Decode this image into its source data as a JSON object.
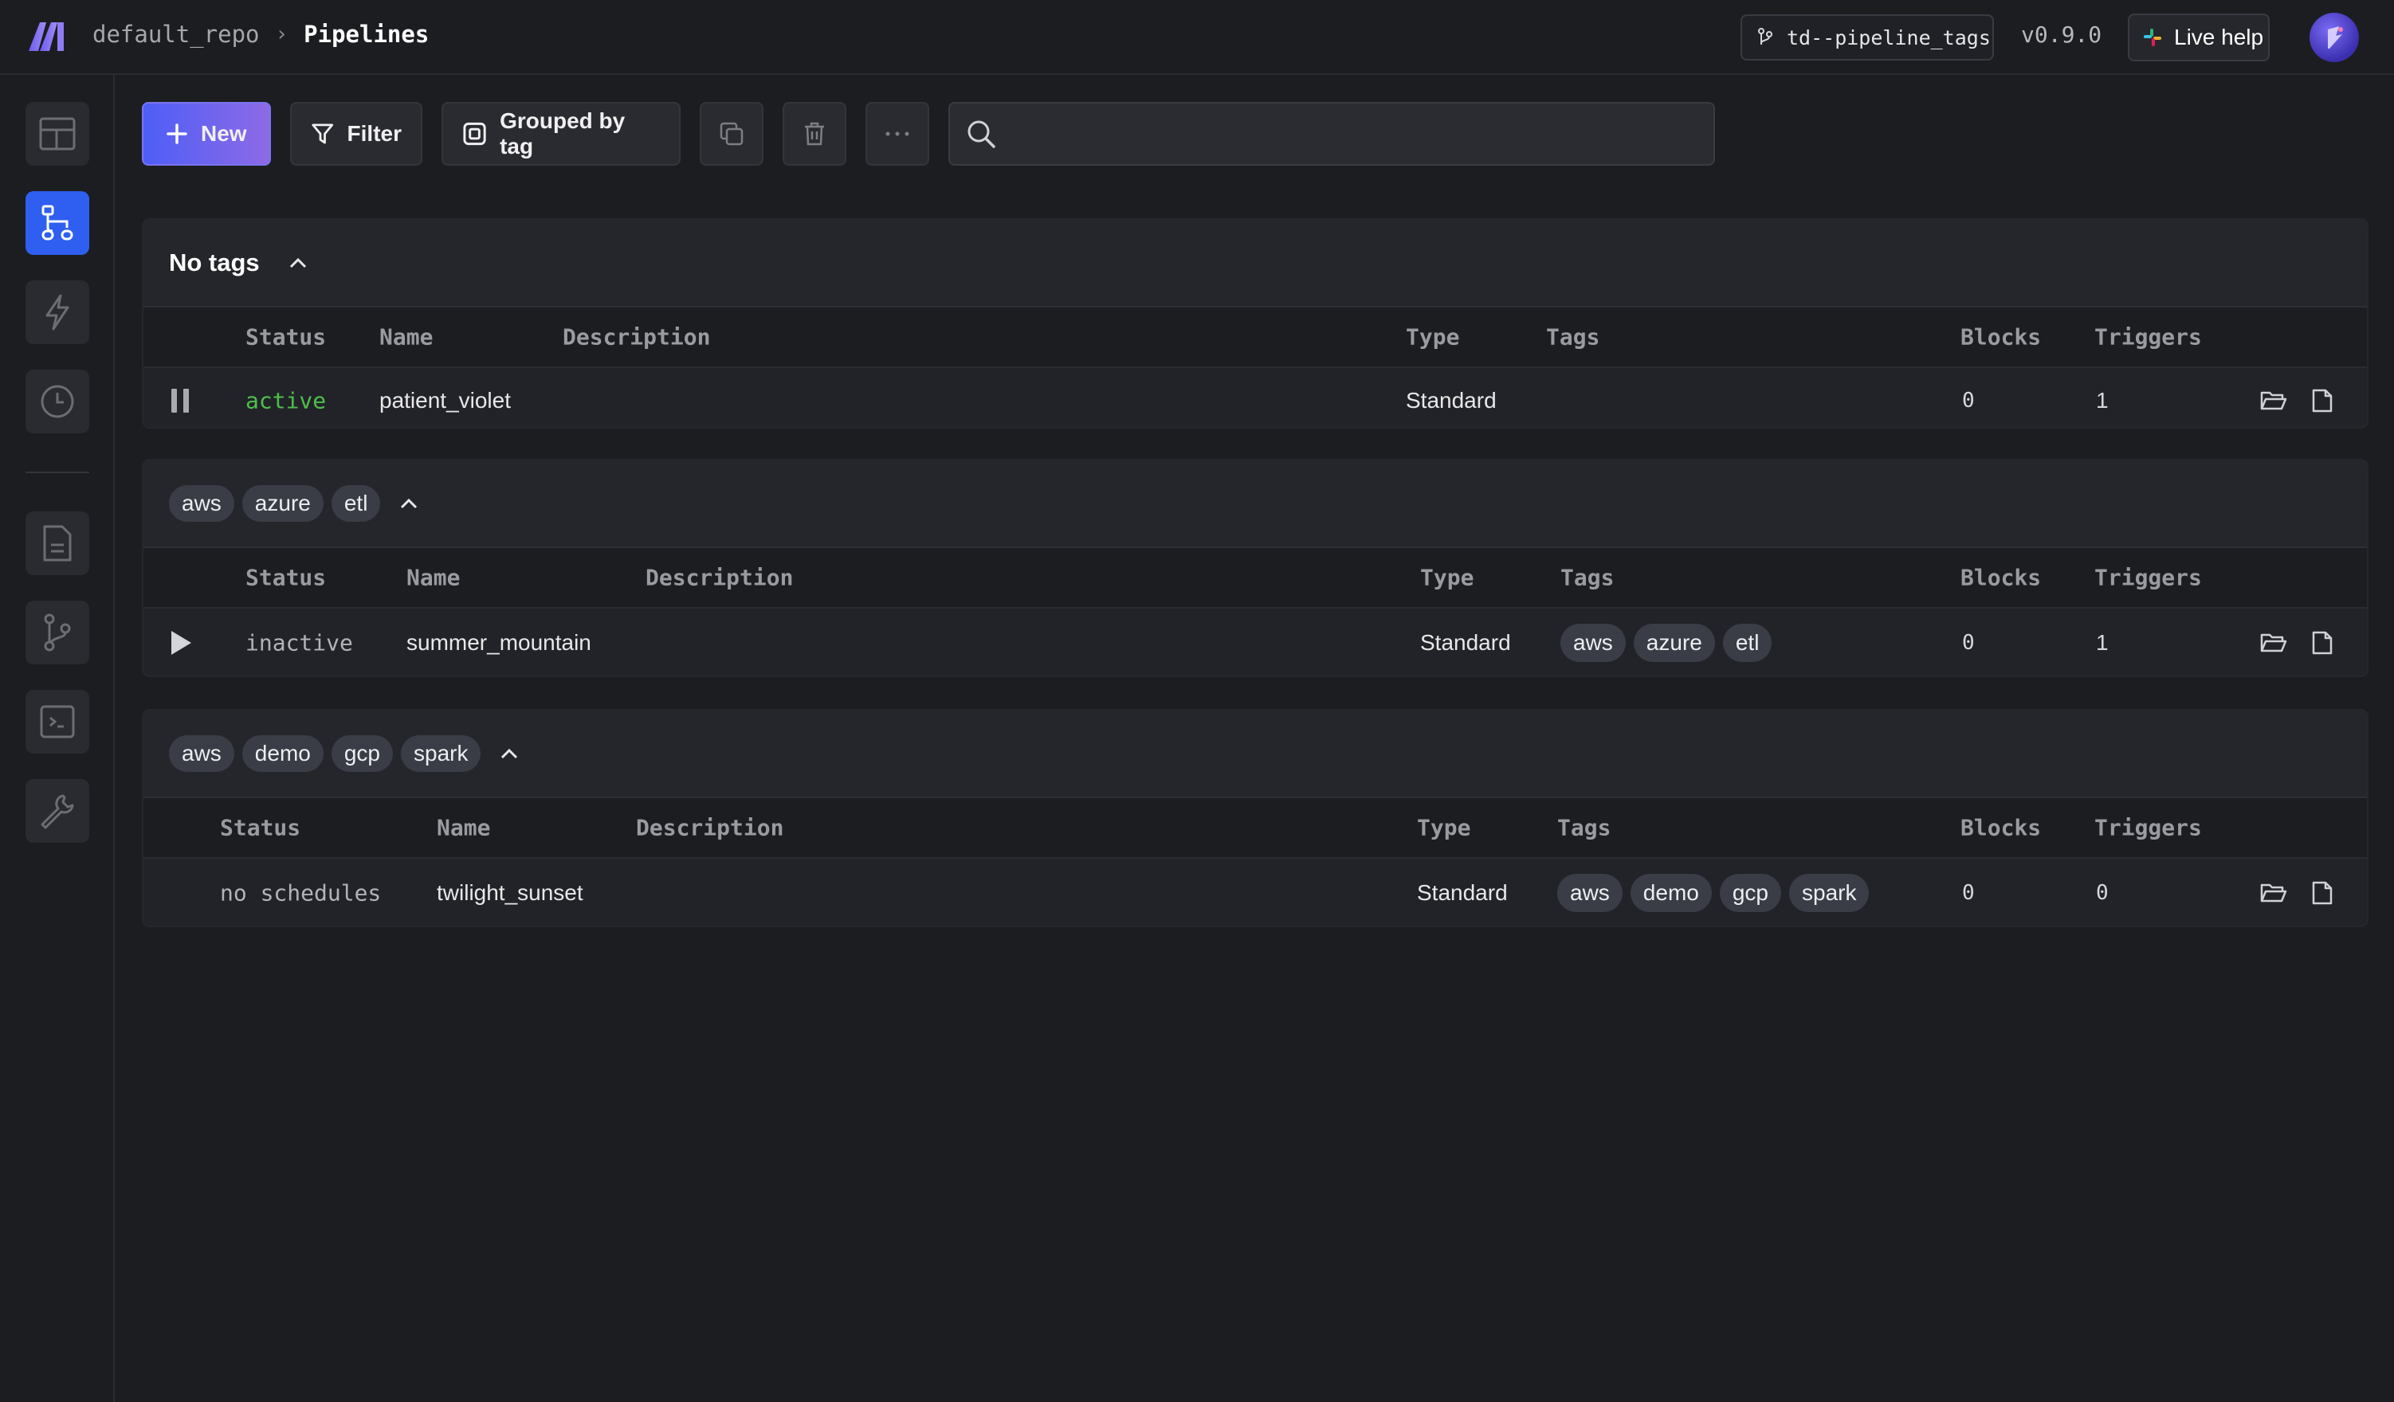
{
  "header": {
    "repo": "default_repo",
    "page_title": "Pipelines",
    "branch": "td--pipeline_tags",
    "version": "v0.9.0",
    "live_help": "Live help"
  },
  "toolbar": {
    "new_label": "New",
    "filter_label": "Filter",
    "group_label": "Grouped by tag",
    "search_placeholder": ""
  },
  "columns": {
    "status": "Status",
    "name": "Name",
    "description": "Description",
    "type": "Type",
    "tags": "Tags",
    "blocks": "Blocks",
    "triggers": "Triggers"
  },
  "groups": [
    {
      "title": "No tags",
      "tags": [],
      "rows": [
        {
          "status": "active",
          "name": "patient_violet",
          "description": "",
          "type": "Standard",
          "tags": [],
          "blocks": "0",
          "triggers": "1"
        }
      ]
    },
    {
      "title": "",
      "tags": [
        "aws",
        "azure",
        "etl"
      ],
      "rows": [
        {
          "status": "inactive",
          "name": "summer_mountain",
          "description": "",
          "type": "Standard",
          "tags": [
            "aws",
            "azure",
            "etl"
          ],
          "blocks": "0",
          "triggers": "1"
        }
      ]
    },
    {
      "title": "",
      "tags": [
        "aws",
        "demo",
        "gcp",
        "spark"
      ],
      "rows": [
        {
          "status": "no schedules",
          "name": "twilight_sunset",
          "description": "",
          "type": "Standard",
          "tags": [
            "aws",
            "demo",
            "gcp",
            "spark"
          ],
          "blocks": "0",
          "triggers": "0"
        }
      ]
    }
  ],
  "colors": {
    "accent": "#2f5ff0",
    "active_status": "#4ebf4a",
    "background": "#1c1d21"
  }
}
